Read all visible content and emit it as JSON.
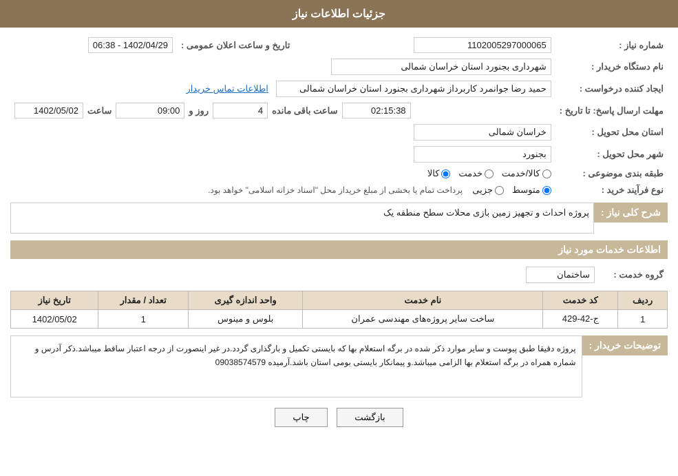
{
  "header": {
    "title": "جزئیات اطلاعات نیاز"
  },
  "fields": {
    "shomara_label": "شماره نیاز :",
    "shomara_value": "1102005297000065",
    "namdastgah_label": "نام دستگاه خریدار :",
    "namdastgah_value": "شهرداری بجنورد استان خراسان شمالی",
    "ijad_label": "ایجاد کننده درخواست :",
    "ijad_value": "حمید رضا جوانمرد کاربرداز شهرداری بجنورد استان خراسان شمالی",
    "ijad_link": "اطلاعات تماس خریدار",
    "mohlat_label": "مهلت ارسال پاسخ: تا تاریخ :",
    "mohlat_date": "1402/05/02",
    "mohlat_saat_label": "ساعت",
    "mohlat_saat_value": "09:00",
    "mohlat_rooz_label": "روز و",
    "mohlat_rooz_value": "4",
    "mohlat_mande_label": "ساعت باقی مانده",
    "mohlat_mande_value": "02:15:38",
    "ostan_label": "استان محل تحویل :",
    "ostan_value": "خراسان شمالی",
    "shahr_label": "شهر محل تحویل :",
    "shahr_value": "بجنورد",
    "tabaqe_label": "طبقه بندی موضوعی :",
    "tabaqe_options": [
      "کالا",
      "خدمت",
      "کالا/خدمت"
    ],
    "tabaqe_selected": "کالا",
    "noe_label": "نوع فرآیند خرید :",
    "noe_options": [
      "جزیی",
      "متوسط"
    ],
    "noe_selected": "متوسط",
    "noe_description": "پرداخت تمام یا بخشی از مبلغ خریداز محل \"اسناد خزانه اسلامی\" خواهد بود.",
    "tarikh_label": "تاریخ و ساعت اعلان عمومی :",
    "tarikh_value": "1402/04/29 - 06:38"
  },
  "sharh_section": {
    "title": "شرح کلی نیاز :",
    "value": "پروژه احداث و تجهیز زمین بازی محلات سطح منطقه یک"
  },
  "khadamat_section": {
    "title": "اطلاعات خدمات مورد نیاز",
    "goroh_label": "گروه خدمت :",
    "goroh_value": "ساختمان"
  },
  "table": {
    "headers": [
      "ردیف",
      "کد خدمت",
      "نام خدمت",
      "واحد اندازه گیری",
      "تعداد / مقدار",
      "تاریخ نیاز"
    ],
    "rows": [
      {
        "radif": "1",
        "code": "ج-42-429",
        "name": "ساخت سایر پروژه‌های مهندسی عمران",
        "vahed": "بلوس و مینوس",
        "tedad": "1",
        "tarikh": "1402/05/02"
      }
    ]
  },
  "tozi_section": {
    "label": "توضیحات خریدار :",
    "text": "پروژه دقیقا طبق پیوست و سایر موارد ذکر شده در برگه استعلام بها که بایستی تکمیل و بارگذاری گردد.در غیر اینصورت از درجه اعتبار ساقط میباشد.ذکر آدرس و شماره همراه در برگه استعلام بها الزامی میباشد.و پیمانکار بایستی بومی استان باشد.آرمیده 09038574579"
  },
  "buttons": {
    "print": "چاپ",
    "back": "بازگشت"
  }
}
